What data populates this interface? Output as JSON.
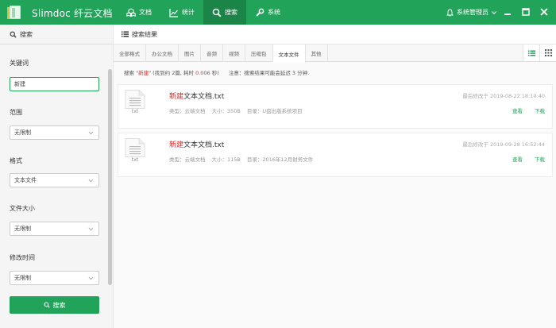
{
  "app": {
    "name": "Slimdoc 纤云文档"
  },
  "nav": [
    {
      "label": "文档",
      "icon": "cubes-icon"
    },
    {
      "label": "统计",
      "icon": "chart-icon"
    },
    {
      "label": "搜索",
      "icon": "search-icon",
      "active": true
    },
    {
      "label": "系统",
      "icon": "wrench-icon"
    }
  ],
  "user": {
    "name": "系统管理员",
    "icon": "bell-icon"
  },
  "sidebar": {
    "title": "搜索",
    "keyword": {
      "label": "关键词",
      "value": "新建"
    },
    "scope": {
      "label": "范围",
      "value": "无限制"
    },
    "format": {
      "label": "格式",
      "value": "文本文件"
    },
    "size": {
      "label": "文件大小",
      "value": "无限制"
    },
    "mtime": {
      "label": "修改时间",
      "value": "无限制"
    },
    "search_button": "搜索"
  },
  "main": {
    "title": "搜索结果",
    "tabs": [
      "全部格式",
      "办公文档",
      "图片",
      "音频",
      "视频",
      "压缩包",
      "文本文件",
      "其他"
    ],
    "active_tab": "文本文件",
    "summary": {
      "prefix": "搜索 \"",
      "keyword": "新建",
      "mid": "\" (找到约 2篇, 耗时 ",
      "seconds": "0.006",
      "suffix": " 秒)",
      "note": "注意：搜索结果可能会延迟 3 分钟."
    },
    "results": [
      {
        "ext": "txt",
        "name_hl": "新建",
        "name_rest": "文本文档.txt",
        "type": "类型：云端文档",
        "size": "大小：350B",
        "dir": "目录：U盘出版系统项目",
        "date": "最后修改于 2019-08-22 18:10:40",
        "view": "查看",
        "download": "下载"
      },
      {
        "ext": "txt",
        "name_hl": "新建",
        "name_rest": "文本文档.txt",
        "type": "类型：云端文档",
        "size": "大小：115B",
        "dir": "目录：2016年12月财务文件",
        "date": "最后修改于 2019-09-28 16:52:44",
        "view": "查看",
        "download": "下载"
      }
    ]
  },
  "colors": {
    "accent": "#22a35a",
    "highlight": "#e12a2a"
  }
}
